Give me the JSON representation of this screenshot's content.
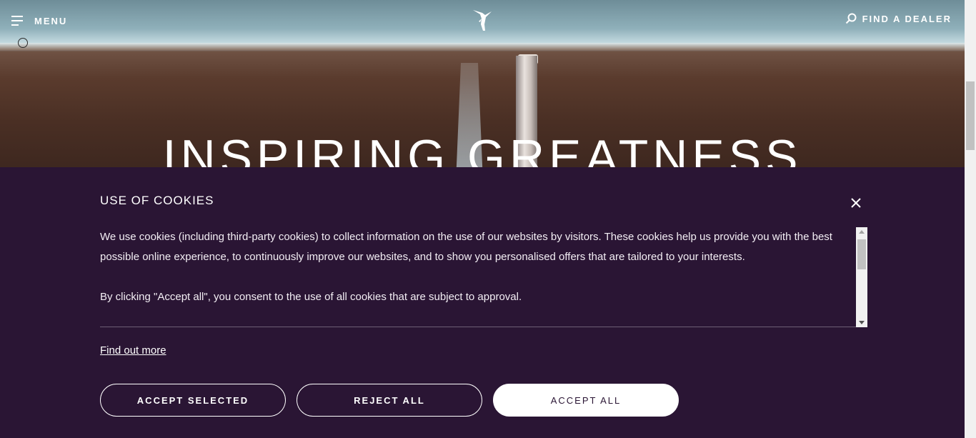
{
  "header": {
    "menu_label": "MENU",
    "dealer_label": "FIND A DEALER"
  },
  "hero": {
    "title": "INSPIRING GREATNESS"
  },
  "cookie": {
    "title": "USE OF COOKIES",
    "paragraphs": [
      "We use cookies (including third-party cookies) to collect information on the use of our websites by visitors. These cookies help us provide you with the best possible online experience, to continuously improve our websites, and to show you personalised offers that are tailored to your interests.",
      "By clicking \"Accept all\", you consent to the use of all cookies that are subject to approval."
    ],
    "find_more": "Find out more",
    "buttons": {
      "accept_selected": "ACCEPT SELECTED",
      "reject_all": "REJECT ALL",
      "accept_all": "ACCEPT ALL"
    }
  },
  "colors": {
    "panel_bg": "#2a1534",
    "text": "#ffffff"
  },
  "icons": {
    "menu": "hamburger-icon",
    "logo": "spirit-of-ecstasy-logo",
    "search": "search-icon",
    "close": "close-icon"
  }
}
